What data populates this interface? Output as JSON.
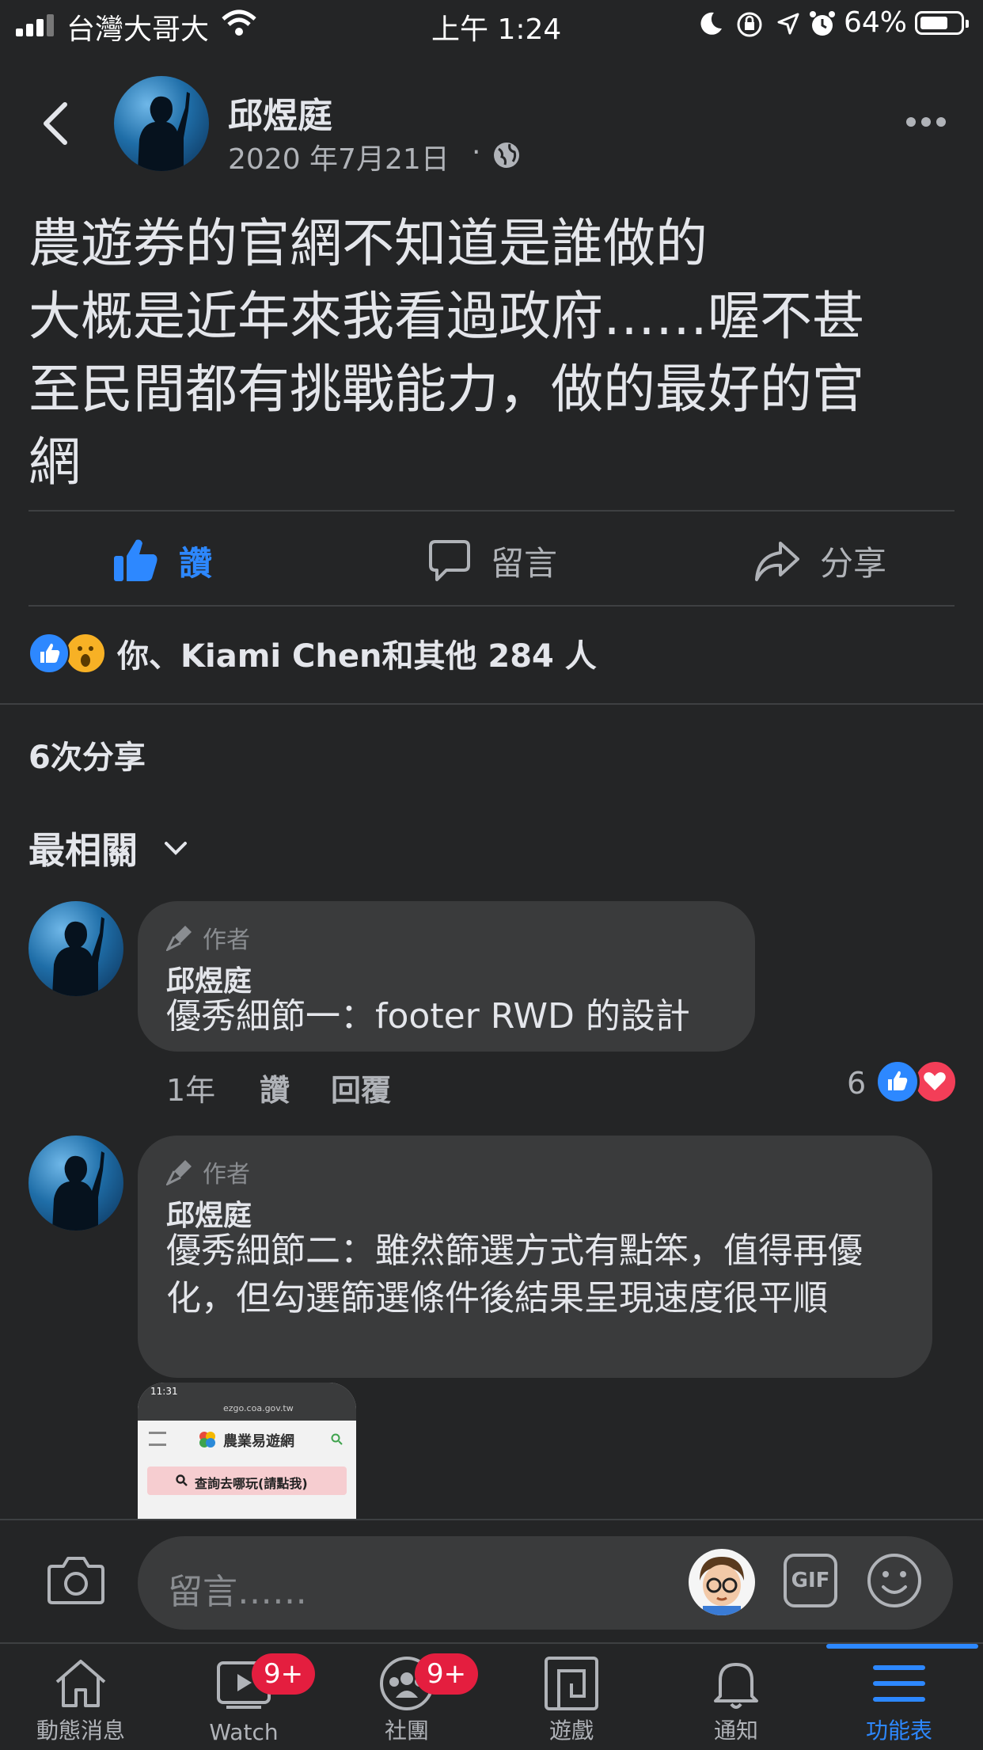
{
  "status_bar": {
    "carrier": "台灣大哥大",
    "time": "上午 1:24",
    "battery": "64%"
  },
  "header": {
    "author": "邱煜庭",
    "date": "2020 年7月21日",
    "separator": "·"
  },
  "post": {
    "text": "農遊券的官網不知道是誰做的\n大概是近年來我看過政府……喔不甚\n至民間都有挑戰能力，做的最好的官\n網"
  },
  "actions": {
    "like": "讚",
    "comment": "留言",
    "share": "分享"
  },
  "reactions": {
    "summary": "你、Kiami Chen和其他 284 人"
  },
  "shares": {
    "count_label": "6次分享"
  },
  "sort": {
    "label": "最相關"
  },
  "comments": [
    {
      "tag": "作者",
      "name": "邱煜庭",
      "text": "優秀細節一：footer RWD 的設計",
      "time": "1年",
      "like": "讚",
      "reply": "回覆",
      "reaction_count": "6"
    },
    {
      "tag": "作者",
      "name": "邱煜庭",
      "text": "優秀細節二：雖然篩選方式有點笨，值得再優化，但勾選篩選條件後結果呈現速度很平順"
    }
  ],
  "attachment": {
    "time": "11:31",
    "url": "ezgo.coa.gov.tw",
    "site_name": "農業易遊網",
    "button": "查詢去哪玩(請點我)"
  },
  "composer": {
    "placeholder": "留言……",
    "gif": "GIF"
  },
  "tabs": [
    {
      "label": "動態消息"
    },
    {
      "label": "Watch",
      "badge": "9+"
    },
    {
      "label": "社團",
      "badge": "9+"
    },
    {
      "label": "遊戲"
    },
    {
      "label": "通知"
    },
    {
      "label": "功能表"
    }
  ],
  "colors": {
    "background": "#242526",
    "accent": "#2d88ff",
    "bubble": "#3a3b3c",
    "badge": "#e41e3f"
  }
}
